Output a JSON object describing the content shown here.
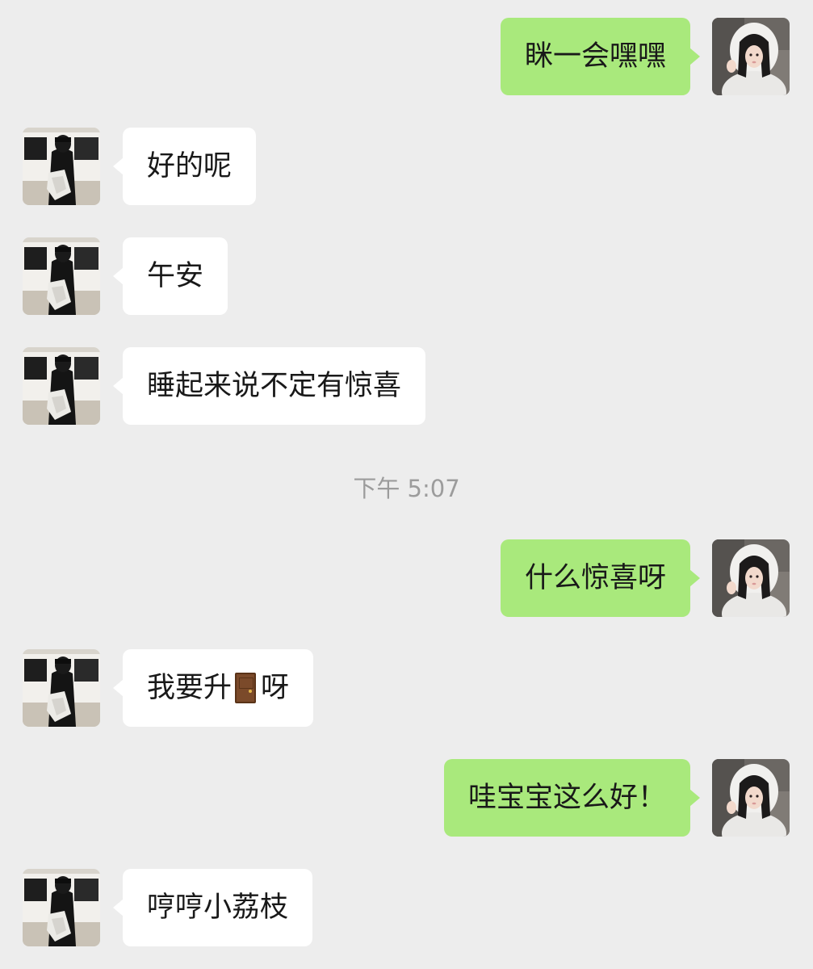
{
  "chat": {
    "messages": [
      {
        "side": "right",
        "text": "眯一会嘿嘿"
      },
      {
        "side": "left",
        "text": "好的呢"
      },
      {
        "side": "left",
        "text": "午安"
      },
      {
        "side": "left",
        "text": "睡起来说不定有惊喜"
      },
      {
        "side": "right",
        "text": "什么惊喜呀"
      },
      {
        "side": "left",
        "text_before": "我要升",
        "emoji": "door-icon",
        "text_after": "呀"
      },
      {
        "side": "right",
        "text": "哇宝宝这么好！"
      },
      {
        "side": "left",
        "text": "哼哼小荔枝"
      }
    ],
    "timestamp": "下午 5:07"
  },
  "colors": {
    "background": "#ededed",
    "sent_bubble": "#a9e97c",
    "received_bubble": "#ffffff",
    "timestamp_text": "#9c9c9c",
    "message_text": "#191919"
  },
  "avatars": {
    "self": "girl-white-hoodie-avatar",
    "contact": "man-black-outfit-car-avatar"
  }
}
